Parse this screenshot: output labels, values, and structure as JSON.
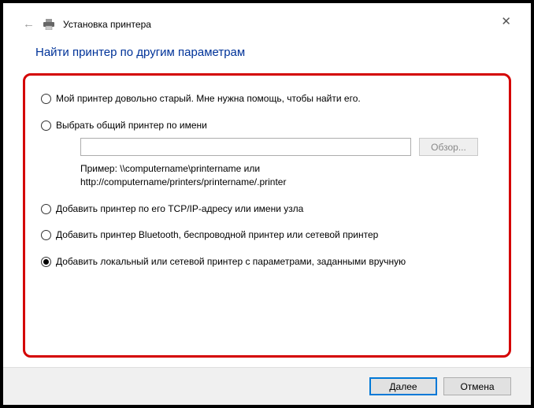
{
  "header": {
    "title": "Установка принтера"
  },
  "main_heading": "Найти принтер по другим параметрам",
  "options": {
    "old_printer": "Мой принтер довольно старый. Мне нужна помощь, чтобы найти его.",
    "shared_by_name": "Выбрать общий принтер по имени",
    "tcp_ip": "Добавить принтер по его TCP/IP-адресу или имени узла",
    "bluetooth": "Добавить принтер Bluetooth, беспроводной принтер или сетевой принтер",
    "manual": "Добавить локальный или сетевой принтер с параметрами, заданными вручную"
  },
  "shared": {
    "input_value": "",
    "browse_label": "Обзор...",
    "example_line1": "Пример: \\\\computername\\printername или",
    "example_line2": "http://computername/printers/printername/.printer"
  },
  "footer": {
    "next": "Далее",
    "cancel": "Отмена"
  }
}
